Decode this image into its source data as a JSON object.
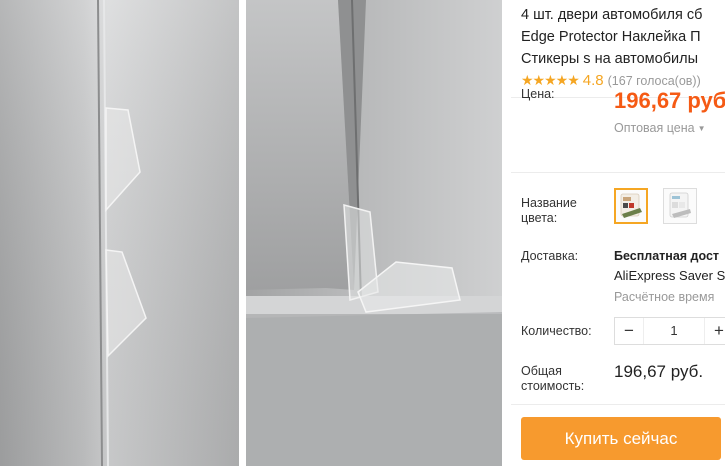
{
  "product": {
    "title_lines": [
      "4 шт. двери автомобиля сб",
      "Edge Protector Наклейка П",
      "Стикеры s на автомобилы"
    ],
    "stars": "★★★★★",
    "rating_value": "4.8",
    "rating_count": "(167 голоса(ов))"
  },
  "price": {
    "label": "Цена:",
    "value": "196,67 руб",
    "wholesale_label": "Оптовая цена"
  },
  "color": {
    "label_line1": "Название",
    "label_line2": "цвета:",
    "selected_index": 0
  },
  "shipping": {
    "label": "Доставка:",
    "line1": "Бесплатная дост",
    "line2": "AliExpress Saver S",
    "line3": "Расчётное время"
  },
  "quantity": {
    "label": "Количество:",
    "value": "1",
    "minus": "−",
    "plus": "+"
  },
  "total": {
    "label_line1": "Общая",
    "label_line2": "стоимость:",
    "value": "196,67 руб."
  },
  "buy_now_label": "Купить сейчас",
  "colors": {
    "price": "#f55a14",
    "stars": "#f5a623",
    "buy_button": "#f79a2e",
    "swatch_selected_border": "#f5a623"
  }
}
